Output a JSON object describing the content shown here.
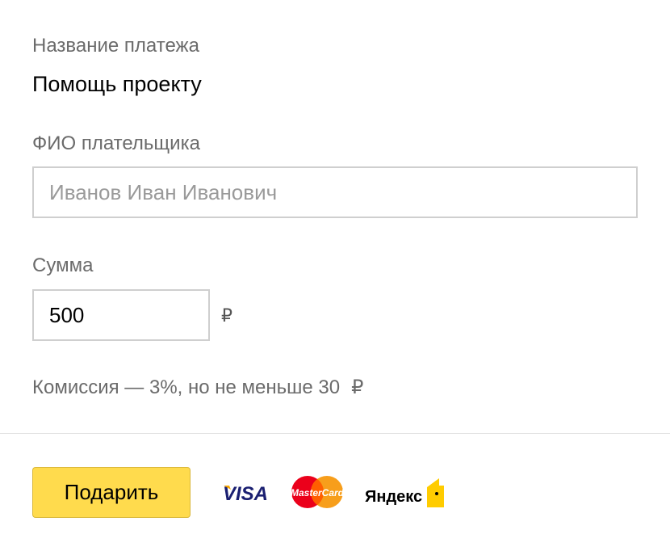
{
  "payment_name": {
    "label": "Название платежа",
    "value": "Помощь проекту"
  },
  "payer_name": {
    "label": "ФИО плательщика",
    "placeholder": "Иванов Иван Иванович",
    "value": ""
  },
  "amount": {
    "label": "Сумма",
    "value": "500",
    "currency": "₽"
  },
  "commission": {
    "text": "Комиссия — 3%, но не меньше 30",
    "currency": "₽"
  },
  "submit": {
    "label": "Подарить"
  },
  "payment_methods": {
    "visa": {
      "icon": "visa-logo-icon",
      "text": "VISA",
      "color": "#1a1f71"
    },
    "mastercard": {
      "icon": "mastercard-logo-icon",
      "text": "MasterCard",
      "colors": [
        "#eb001b",
        "#f79e1b"
      ]
    },
    "yandex": {
      "icon": "yandex-money-logo-icon",
      "text": "Яндекс",
      "colors": [
        "#ff0000",
        "#ffcc00"
      ]
    }
  },
  "colors": {
    "button_bg": "#ffdb4d",
    "label": "#6b6b6b",
    "input_border": "#cfcfcf"
  }
}
